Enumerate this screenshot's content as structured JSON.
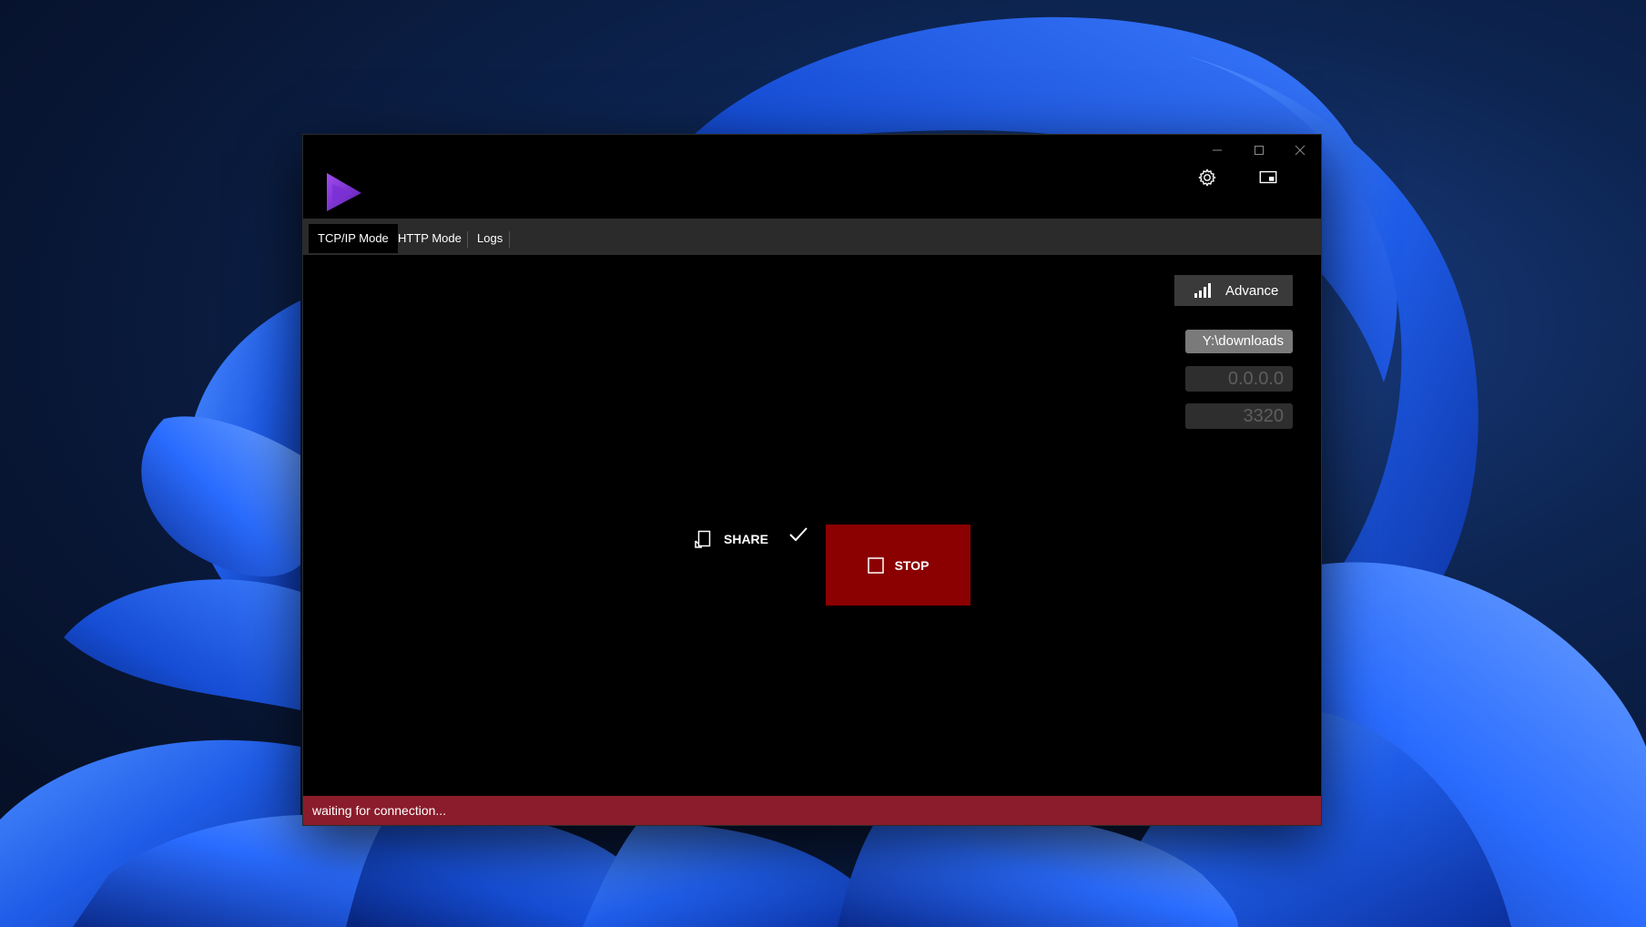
{
  "window": {
    "caption_buttons": [
      "minimize-icon",
      "maximize-icon",
      "close-icon"
    ],
    "header_icons": [
      "gear-icon",
      "compact-overlay-icon"
    ]
  },
  "tabs": [
    {
      "label": "TCP/IP Mode",
      "active": true
    },
    {
      "label": "HTTP Mode",
      "active": false
    },
    {
      "label": "Logs",
      "active": false
    }
  ],
  "settings": {
    "advance_label": "Advance",
    "folder_path": "Y:\\downloads",
    "ip_address": "0.0.0.0",
    "port": "3320"
  },
  "actions": {
    "share_label": "SHARE",
    "stop_label": "STOP"
  },
  "status": {
    "text": "waiting for connection..."
  },
  "colors": {
    "stop_button": "#8b0000",
    "status_bar": "#8a1c2b",
    "logo": "#7b2fd6"
  }
}
